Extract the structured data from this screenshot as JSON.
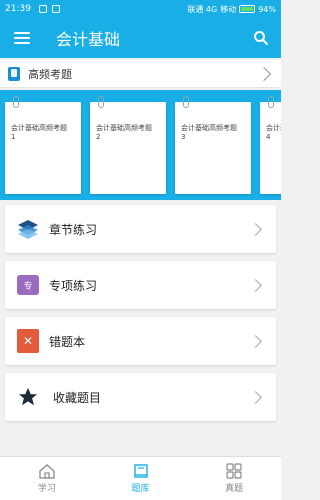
{
  "status_bar": {
    "time": "21:39",
    "carrier1": "联通 4G",
    "carrier2": "移动",
    "battery": "94%"
  },
  "app_bar": {
    "title": "会计基础"
  },
  "section": {
    "label": "高频考题"
  },
  "cards": [
    {
      "line1": "会计基础高频考题",
      "line2": "1"
    },
    {
      "line1": "会计基础高频考题",
      "line2": "2"
    },
    {
      "line1": "会计基础高频考题",
      "line2": "3"
    },
    {
      "line1": "会计基础高频考题",
      "line2": "4"
    }
  ],
  "menu": [
    {
      "label": "章节练习",
      "icon": "layers-icon"
    },
    {
      "label": "专项练习",
      "icon": "special-icon",
      "icon_text": "专"
    },
    {
      "label": "错题本",
      "icon": "wrong-icon",
      "icon_text": "✕"
    },
    {
      "label": "收藏题目",
      "icon": "star-icon"
    }
  ],
  "bottom_nav": [
    {
      "label": "学习",
      "active": false
    },
    {
      "label": "题库",
      "active": true
    },
    {
      "label": "真题",
      "active": false
    }
  ],
  "colors": {
    "primary": "#1aaee7"
  }
}
